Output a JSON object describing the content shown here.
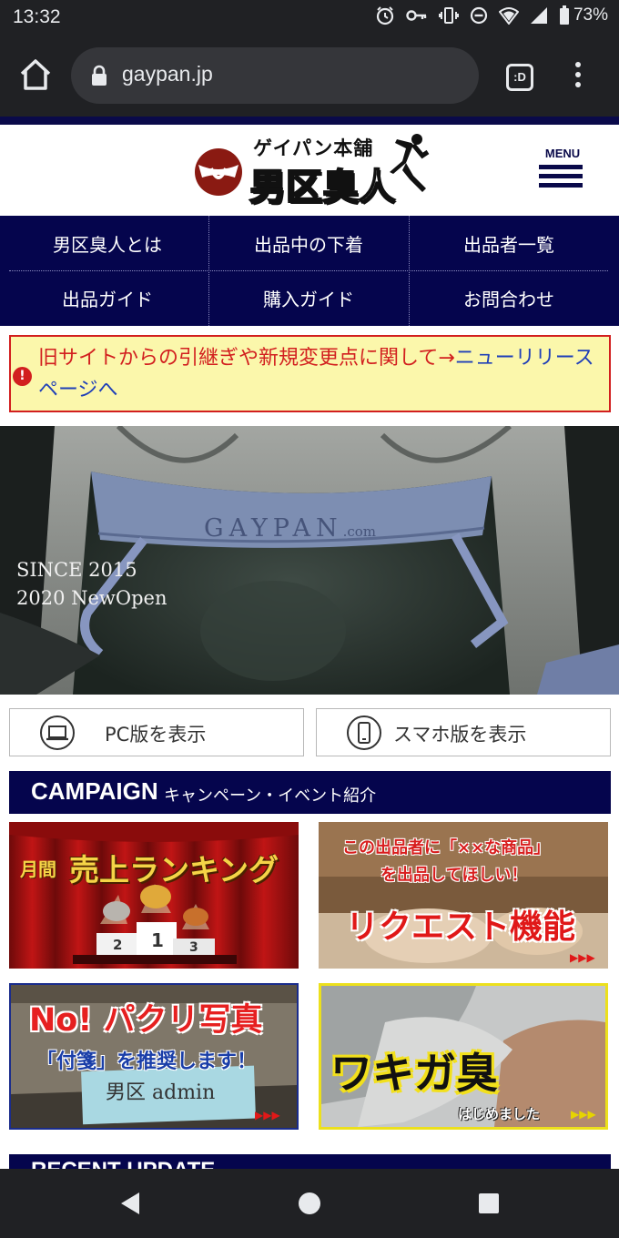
{
  "status_bar": {
    "time": "13:32",
    "battery": "73%"
  },
  "browser": {
    "url": "gaypan.jp",
    "tabs_label": ":D"
  },
  "header": {
    "logo_sub": "ゲイパン本舗",
    "logo_main": "男区臭人",
    "menu_label": "MENU"
  },
  "nav": {
    "items": [
      "男区臭人とは",
      "出品中の下着",
      "出品者一覧",
      "出品ガイド",
      "購入ガイド",
      "お問合わせ"
    ]
  },
  "notice": {
    "text_red": "旧サイトからの引継ぎや新規変更点に関して→",
    "text_link": "ニューリリースページへ"
  },
  "hero": {
    "brand": "GAYPAN",
    "brand_suffix": ".com",
    "line1": "SINCE 2015",
    "line2": "2020 NewOpen"
  },
  "view_switch": {
    "pc_label": "PC版を表示",
    "sp_label": "スマホ版を表示"
  },
  "campaign": {
    "title": "CAMPAIGN",
    "subtitle": "キャンペーン・イベント紹介"
  },
  "banners": {
    "ranking": {
      "prefix": "月間",
      "title": "売上ランキング",
      "podium": [
        "2",
        "1",
        "3"
      ]
    },
    "request": {
      "line1": "この出品者に「××な商品」",
      "line2": "を出品してほしい！",
      "title": "リクエスト機能"
    },
    "nopakuri": {
      "title": "No! パクリ写真",
      "line2": "「付箋」を推奨します！",
      "note": "男区 admin"
    },
    "wakiga": {
      "title": "ワキガ臭",
      "sub": "はじめました"
    },
    "arrows": "▶▶▶"
  },
  "recent": {
    "title": "RECENT UPDATE"
  },
  "colors": {
    "navy": "#05054d",
    "red": "#d21f1f",
    "link_blue": "#1f3fb8",
    "notice_bg": "#fbf7ab"
  }
}
